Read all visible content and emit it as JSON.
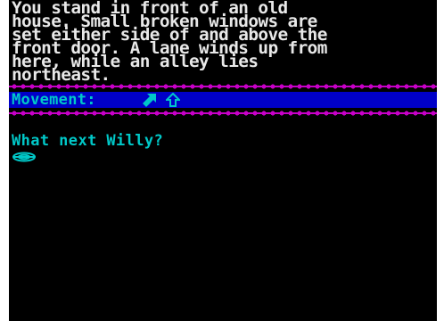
{
  "description": {
    "lines": [
      "You stand in front of an old",
      "house. Small broken windows are",
      "set either side of and above the",
      "front door. A lane winds up from",
      "here, while an alley lies",
      "northeast."
    ]
  },
  "movement": {
    "label": "Movement:",
    "exits": [
      {
        "direction": "northeast",
        "icon": "arrow-northeast-icon"
      },
      {
        "direction": "north",
        "icon": "arrow-north-outline-icon"
      }
    ]
  },
  "prompt": {
    "text": "What next Willy?"
  },
  "colors": {
    "screen_bg": "#000000",
    "page_bg": "#ffffff",
    "description_text": "#e8e8e8",
    "bar_bg": "#0000c8",
    "bar_text": "#00c8c8",
    "border_magenta": "#c800c8",
    "prompt_text": "#00c8c8",
    "cursor": "#00c8c8"
  }
}
